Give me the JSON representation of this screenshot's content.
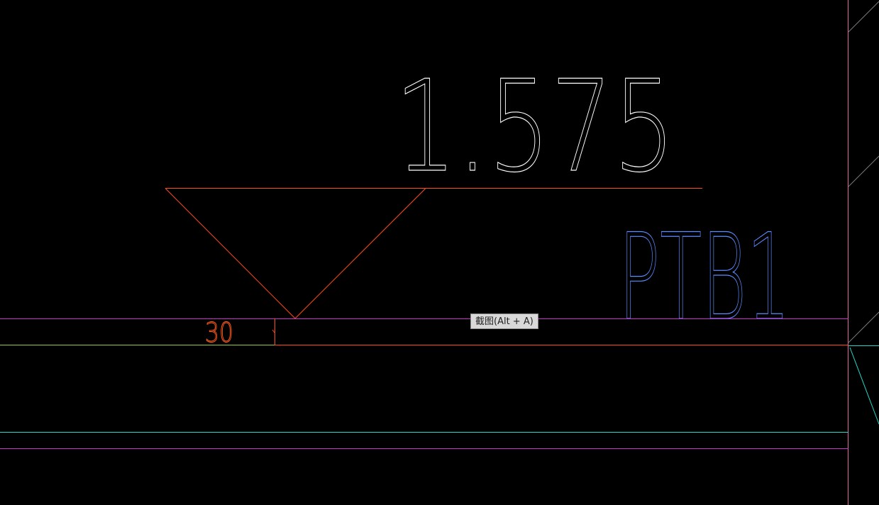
{
  "drawing": {
    "elevation_value": "1.575",
    "member_label": "PTB1",
    "dimension_value": "30",
    "colors": {
      "background": "#000000",
      "elevation_text": "#ffffff",
      "elevation_symbol": "#ff4a1a",
      "member_label": "#5b8cff",
      "dimension_text": "#ff5a1a",
      "magenta_line": "#c832c8",
      "green_line": "#9acd32",
      "cyan_line": "#20d8c8",
      "border_line": "#e06aa0"
    }
  },
  "tooltip": {
    "text": "截图(Alt + A)"
  }
}
